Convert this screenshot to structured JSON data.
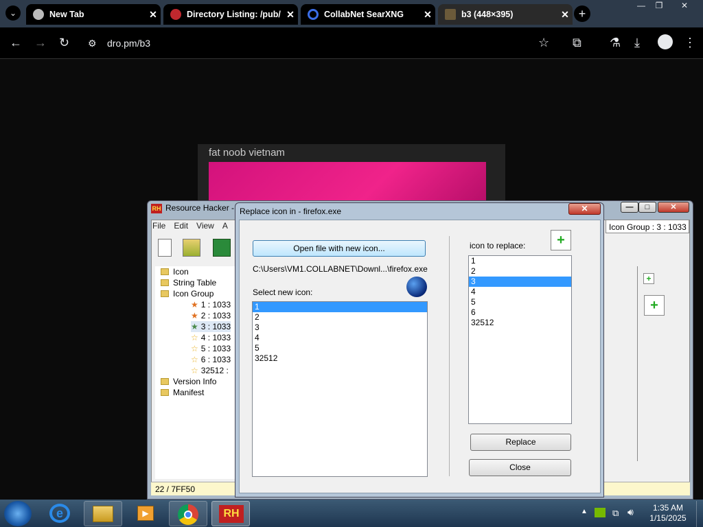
{
  "browser": {
    "tabs": [
      {
        "title": "New Tab",
        "active": false
      },
      {
        "title": "Directory Listing: /pub/",
        "active": false
      },
      {
        "title": "CollabNet SearXNG",
        "active": false
      },
      {
        "title": "b3 (448×395)",
        "active": true
      }
    ],
    "url": "dro.pm/b3"
  },
  "page": {
    "image_title": "fat noob vietnam"
  },
  "reshacker": {
    "title": "Resource Hacker -",
    "menu": [
      "File",
      "Edit",
      "View",
      "A"
    ],
    "tree": [
      {
        "label": "Icon",
        "type": "folder"
      },
      {
        "label": "String Table",
        "type": "folder"
      },
      {
        "label": "Icon Group",
        "type": "folder"
      },
      {
        "label": "1 : 1033",
        "type": "star"
      },
      {
        "label": "2 : 1033",
        "type": "star"
      },
      {
        "label": "3 : 1033",
        "type": "star"
      },
      {
        "label": "4 : 1033",
        "type": "star"
      },
      {
        "label": "5 : 1033",
        "type": "star"
      },
      {
        "label": "6 : 1033",
        "type": "star"
      },
      {
        "label": "32512 :",
        "type": "star"
      },
      {
        "label": "Version Info",
        "type": "folder"
      },
      {
        "label": "Manifest",
        "type": "folder"
      }
    ],
    "header_right": "Icon Group : 3 : 1033",
    "status": "22 / 7FF50"
  },
  "dialog": {
    "title": "Replace icon in - firefox.exe",
    "close_label": "✕",
    "open_button": "Open file with new icon...",
    "file_path": "C:\\Users\\VM1.COLLABNET\\Downl...\\firefox.exe",
    "select_label": "Select new icon:",
    "new_icons": [
      "1",
      "2",
      "3",
      "4",
      "5",
      "32512"
    ],
    "new_icons_selected": 0,
    "replace_label": "icon to replace:",
    "replace_icons": [
      "1",
      "2",
      "3",
      "4",
      "5",
      "6",
      "32512"
    ],
    "replace_icons_selected": 2,
    "replace_button": "Replace",
    "close_button": "Close"
  },
  "taskbar": {
    "time": "1:35 AM",
    "date": "1/15/2025",
    "rh_label": "RH"
  }
}
